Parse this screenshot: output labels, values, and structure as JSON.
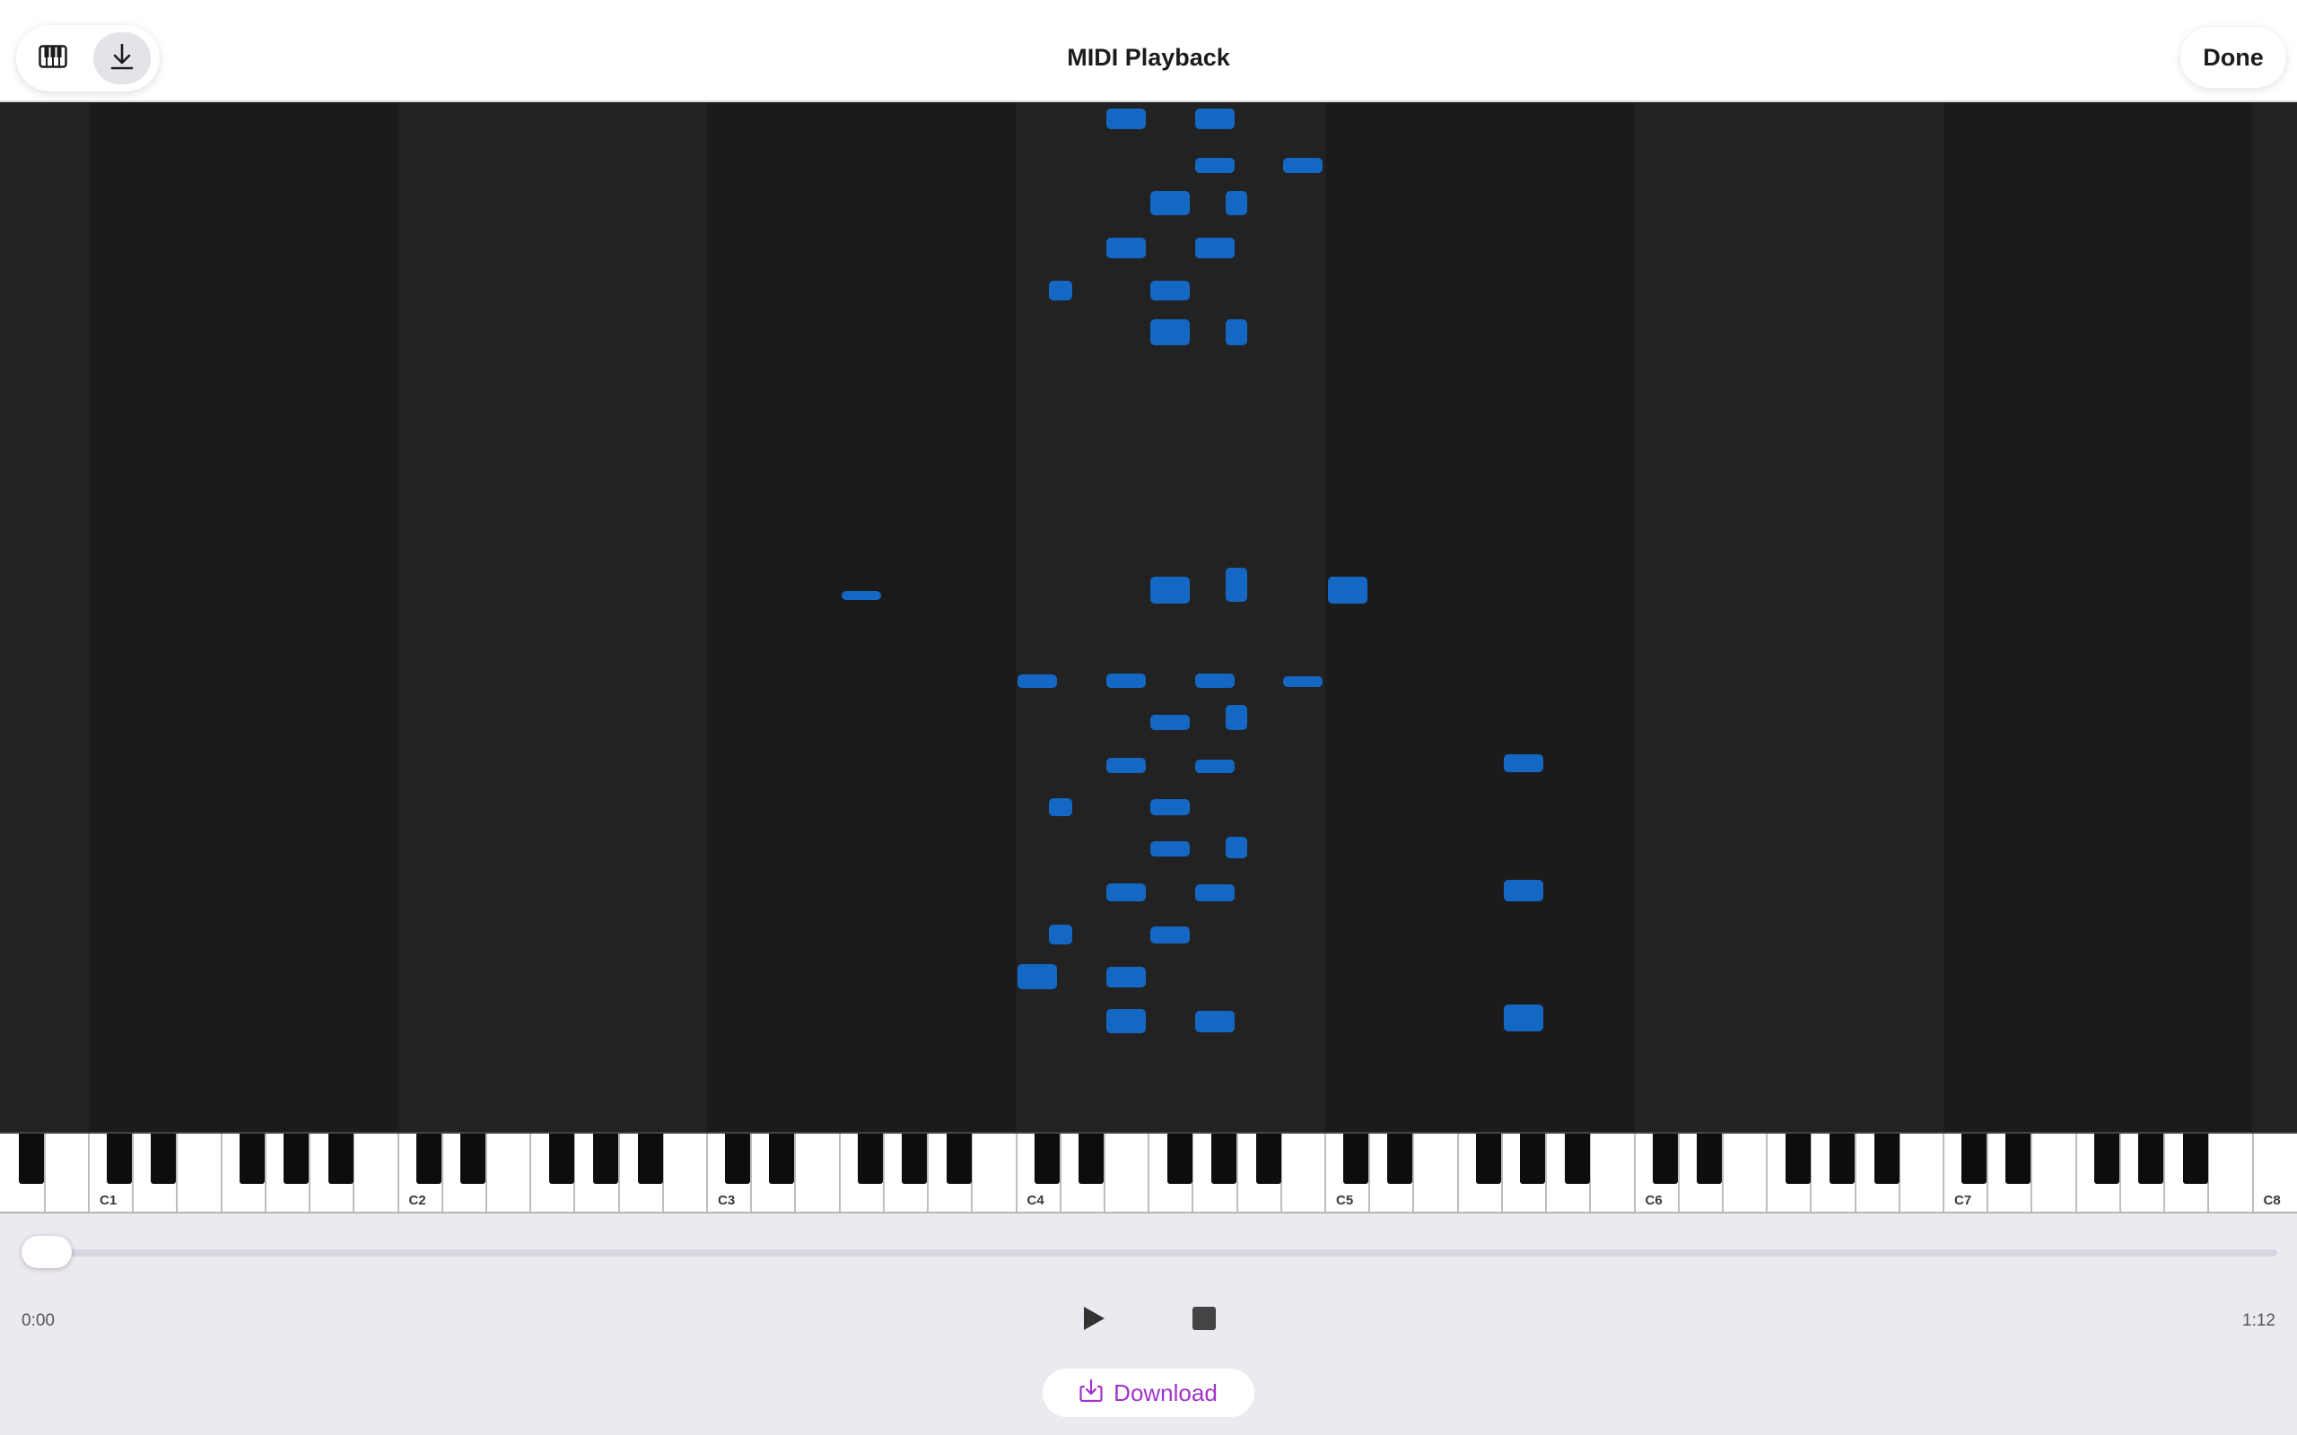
{
  "window": {
    "title": "MIDI Playback",
    "done_label": "Done"
  },
  "toolbar": {
    "keyboard_icon": "piano-keys-icon",
    "download_icon": "download-arrow-icon",
    "selected": "download"
  },
  "keyboard": {
    "octave_labels": [
      "C1",
      "C2",
      "C3",
      "C4",
      "C5",
      "C6",
      "C7",
      "C8"
    ]
  },
  "player": {
    "current_time": "0:00",
    "total_time": "1:12",
    "progress": 0.0
  },
  "download": {
    "label": "Download"
  },
  "colors": {
    "accent": "#1468c4",
    "download_text": "#a332c9",
    "roll_bg": "#1b1b1b"
  }
}
